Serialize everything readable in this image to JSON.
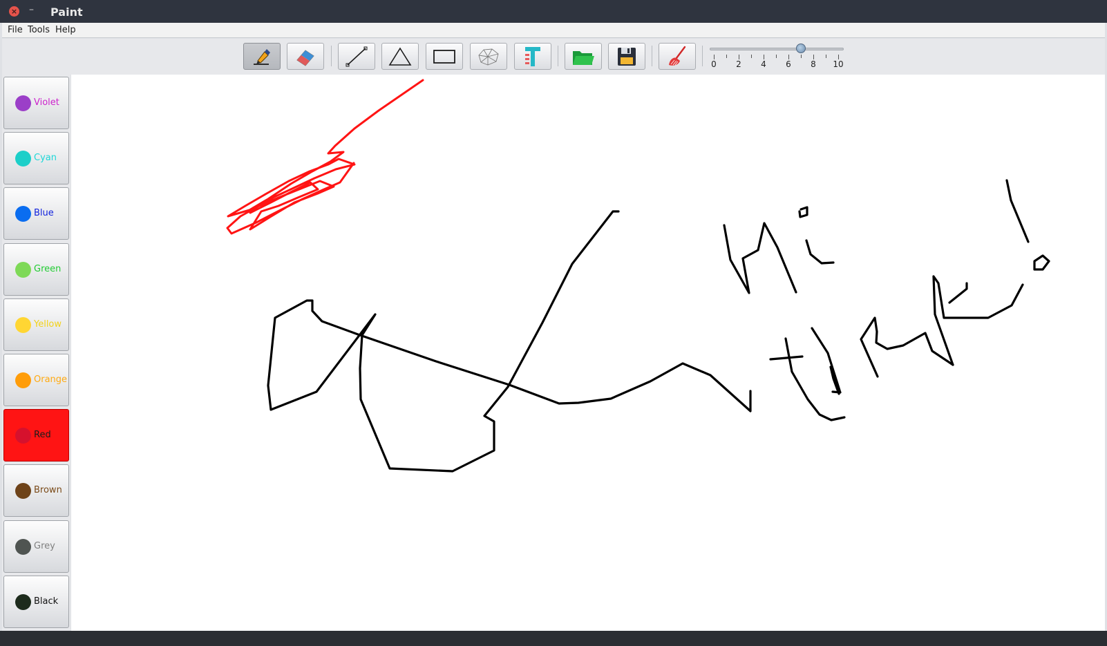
{
  "window": {
    "title": "Paint"
  },
  "menubar": {
    "items": [
      {
        "label": "File"
      },
      {
        "label": "Tools"
      },
      {
        "label": "Help"
      }
    ]
  },
  "toolbar": {
    "tools": [
      {
        "name": "pen-icon",
        "active": true
      },
      {
        "name": "eraser-icon",
        "active": false
      },
      {
        "name": "line-icon",
        "active": false
      },
      {
        "name": "triangle-icon",
        "active": false
      },
      {
        "name": "rectangle-icon",
        "active": false
      },
      {
        "name": "polygon-icon",
        "active": false
      },
      {
        "name": "text-icon",
        "active": false
      },
      {
        "name": "folder-open-icon",
        "active": false
      },
      {
        "name": "save-icon",
        "active": false
      },
      {
        "name": "broom-icon",
        "active": false
      }
    ],
    "brush_size": {
      "min": 0,
      "max": 10,
      "value": 7,
      "labels": [
        "0",
        "2",
        "4",
        "6",
        "8",
        "10"
      ]
    }
  },
  "palette": {
    "colors": [
      {
        "label": "Violet",
        "dot": "#9b3fc8",
        "text": "#cc22cc",
        "bg": ""
      },
      {
        "label": "Cyan",
        "dot": "#1ccfc9",
        "text": "#1ed8d8",
        "bg": ""
      },
      {
        "label": "Blue",
        "dot": "#0a6df0",
        "text": "#1122dd",
        "bg": ""
      },
      {
        "label": "Green",
        "dot": "#7ed957",
        "text": "#22cc33",
        "bg": ""
      },
      {
        "label": "Yellow",
        "dot": "#ffd633",
        "text": "#f2d21a",
        "bg": ""
      },
      {
        "label": "Orange",
        "dot": "#ff9d0a",
        "text": "#ffaa11",
        "bg": ""
      },
      {
        "label": "Red",
        "dot": "#d6112d",
        "text": "#1b1b1b",
        "bg": "#ff1414"
      },
      {
        "label": "Brown",
        "dot": "#6e4319",
        "text": "#7a4a18",
        "bg": ""
      },
      {
        "label": "Grey",
        "dot": "#4f5451",
        "text": "#808080",
        "bg": ""
      },
      {
        "label": "Black",
        "dot": "#1d2b1c",
        "text": "#111111",
        "bg": ""
      }
    ]
  },
  "canvas": {
    "stroke_colors": {
      "red": "#ff1414",
      "black": "#000000"
    }
  }
}
